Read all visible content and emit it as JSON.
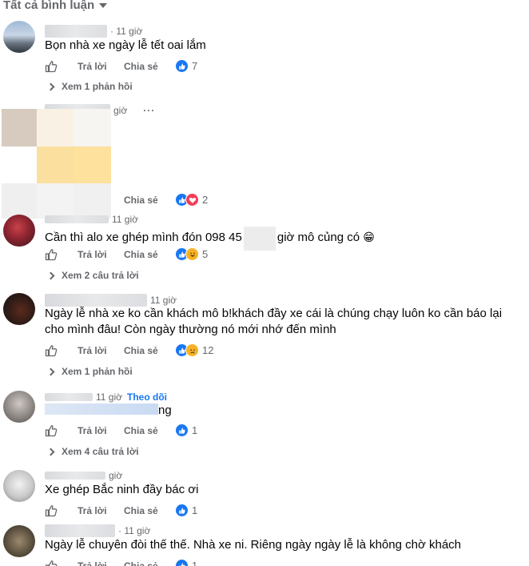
{
  "header": {
    "label": "Tất cả bình luận"
  },
  "actions": {
    "reply": "Trả lời",
    "share": "Chia sẻ"
  },
  "comments": [
    {
      "time": "· 11 giờ",
      "text": "Bọn nhà xe ngày lễ tết oai lắm",
      "react_count": "7",
      "replies": "Xem 1 phản hồi"
    },
    {
      "time": "giờ",
      "more": "···",
      "react_count": "2"
    },
    {
      "time": "11 giờ",
      "text_a": "Cần thì alo xe ghép mình đón 098 45",
      "text_b": "giờ mô củng có",
      "emoji": "😁",
      "react_count": "5",
      "replies": "Xem 2 câu trả lời"
    },
    {
      "time": "11 giờ",
      "text": "Ngày lễ nhà xe ko cần khách mô b!khách đầy xe cái là chúng chạy luôn ko cần báo lại cho mình đâu! Còn ngày thường nó mới nhớ đến mình",
      "react_count": "12",
      "replies": "Xem 1 phản hồi"
    },
    {
      "time": "11 giờ",
      "follow": "Theo dõi",
      "text": "ng",
      "react_count": "1",
      "replies": "Xem 4 câu trả lời"
    },
    {
      "time": "giờ",
      "text": "Xe ghép Bắc ninh đầy bác ơi",
      "react_count": "1"
    },
    {
      "time": "· 11 giờ",
      "text": "Ngày lễ chuyên đòi thế thế. Nhà xe ni. Riêng ngày ngày lễ là không chờ khách",
      "react_count": "1"
    }
  ],
  "colors": {
    "secondary_text": "#65676b",
    "like_blue": "#1877f2",
    "love_red": "#f33e58",
    "haha_yellow": "#f7b125"
  },
  "icons": [
    "thumbs-up-icon",
    "like-reaction-icon",
    "love-reaction-icon",
    "haha-reaction-icon",
    "sad-reaction-icon",
    "chevron-down-icon"
  ]
}
